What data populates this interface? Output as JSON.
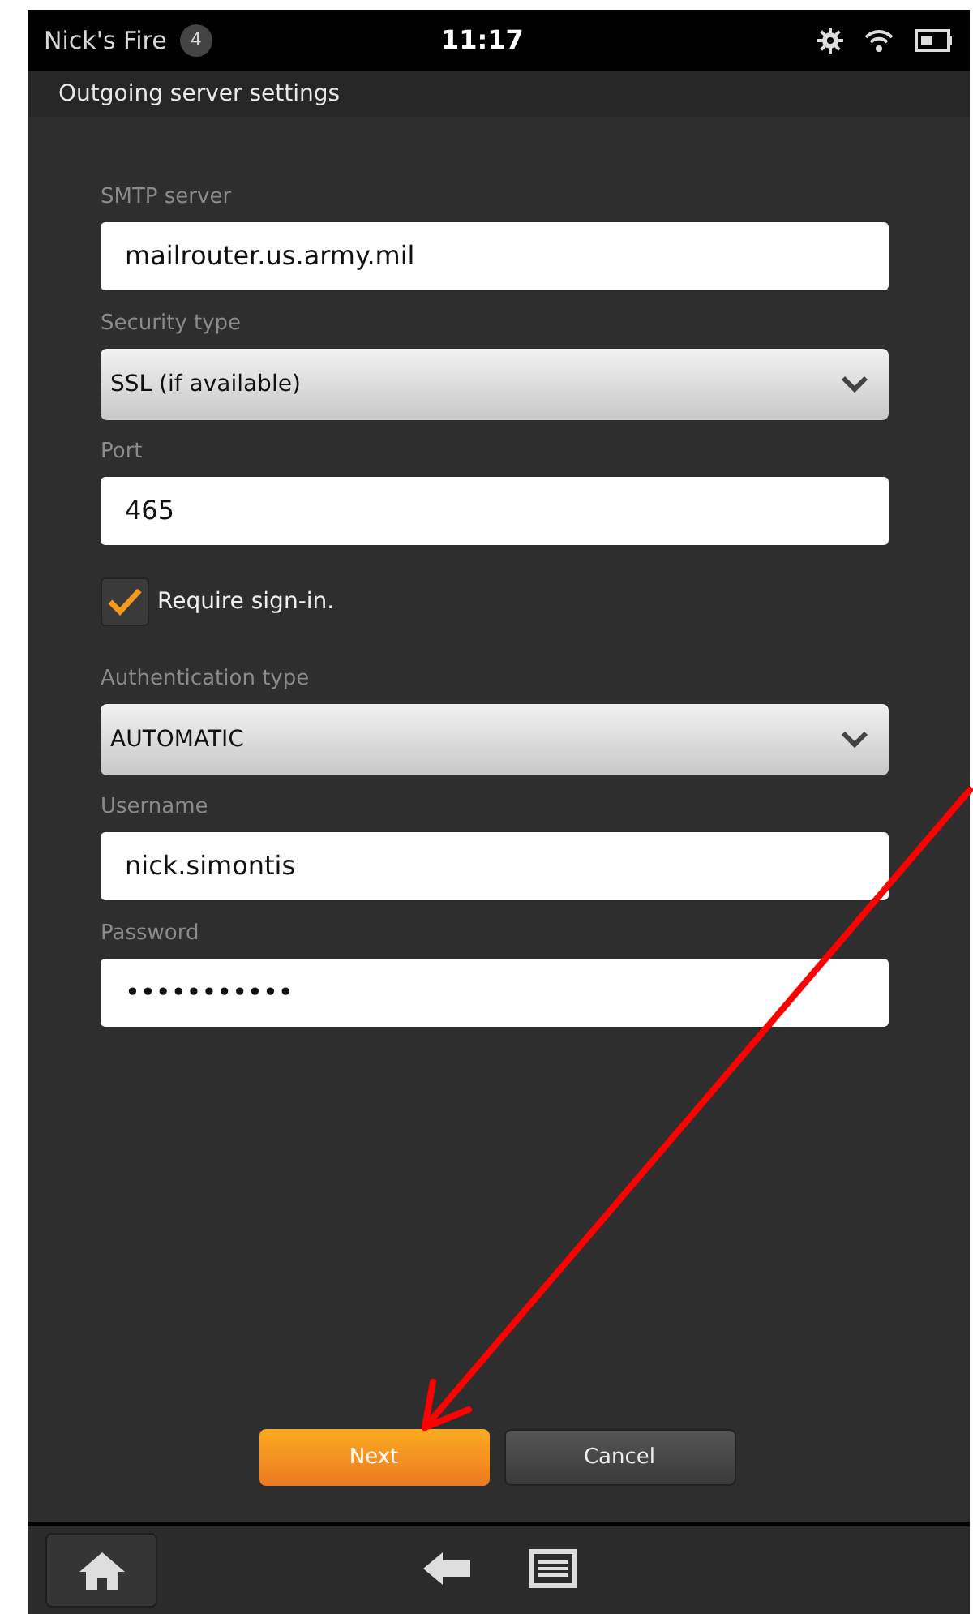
{
  "status_bar": {
    "device_name": "Nick's Fire",
    "notification_count": "4",
    "time": "11:17"
  },
  "title_bar": {
    "title": "Outgoing server settings"
  },
  "form": [
    {
      "kind": "text",
      "label": "SMTP server",
      "value": "mailrouter.us.army.mil"
    },
    {
      "kind": "select",
      "label": "Security type",
      "value": "SSL (if available)"
    },
    {
      "kind": "text",
      "label": "Port",
      "value": "465"
    },
    {
      "kind": "checkbox",
      "label": "Require sign-in.",
      "checked": true
    },
    {
      "kind": "select",
      "label": "Authentication type",
      "value": "AUTOMATIC"
    },
    {
      "kind": "text",
      "label": "Username",
      "value": "nick.simontis"
    },
    {
      "kind": "text",
      "label": "Password",
      "value": "•••••••••••"
    }
  ],
  "buttons": [
    {
      "label": "Next",
      "primary": true
    },
    {
      "label": "Cancel",
      "primary": false
    }
  ]
}
